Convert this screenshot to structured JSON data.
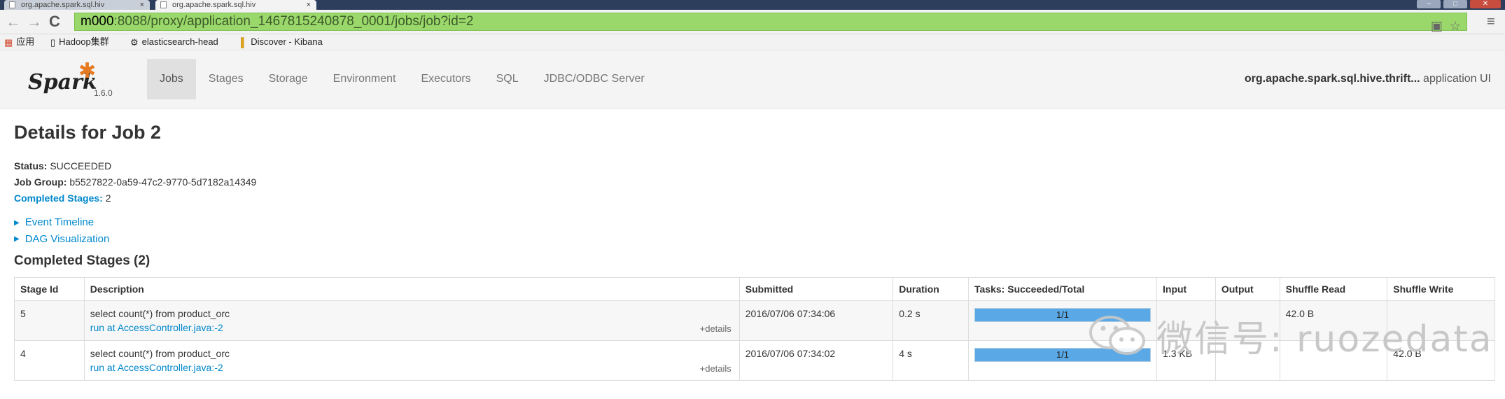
{
  "browser": {
    "tabs": [
      {
        "title": "org.apache.spark.sql.hiv",
        "active": false
      },
      {
        "title": "org.apache.spark.sql.hiv",
        "active": true
      }
    ],
    "tab_close": "×",
    "url_host": "m000",
    "url_rest": ":8088/proxy/application_1467815240878_0001/jobs/job?id=2",
    "bookmarks": [
      "应用",
      "Hadoop集群",
      "elasticsearch-head",
      "Discover - Kibana"
    ]
  },
  "spark_nav": {
    "logo_text": "Spark",
    "version": "1.6.0",
    "tabs": [
      "Jobs",
      "Stages",
      "Storage",
      "Environment",
      "Executors",
      "SQL",
      "JDBC/ODBC Server"
    ],
    "active_tab": "Jobs",
    "app_name": "org.apache.spark.sql.hive.thrift...",
    "app_suffix": " application UI"
  },
  "job": {
    "heading": "Details for Job 2",
    "status_label": "Status:",
    "status_value": " SUCCEEDED",
    "group_label": "Job Group:",
    "group_value": " b5527822-0a59-47c2-9770-5d7182a14349",
    "completed_label": "Completed Stages:",
    "completed_value": " 2"
  },
  "toggles": {
    "event_timeline": "Event Timeline",
    "dag": "DAG Visualization"
  },
  "stages_section": {
    "heading": "Completed Stages (2)",
    "columns": [
      "Stage Id",
      "Description",
      "Submitted",
      "Duration",
      "Tasks: Succeeded/Total",
      "Input",
      "Output",
      "Shuffle Read",
      "Shuffle Write"
    ],
    "rows": [
      {
        "stage_id": "5",
        "desc": "select count(*) from product_orc",
        "desc_link": "run at AccessController.java:-2",
        "details": "+details",
        "submitted": "2016/07/06 07:34:06",
        "duration": "0.2 s",
        "tasks": "1/1",
        "tasks_fraction": 1.0,
        "input": "",
        "output": "",
        "shuffle_read": "42.0 B",
        "shuffle_write": ""
      },
      {
        "stage_id": "4",
        "desc": "select count(*) from product_orc",
        "desc_link": "run at AccessController.java:-2",
        "details": "+details",
        "submitted": "2016/07/06 07:34:02",
        "duration": "4 s",
        "tasks": "1/1",
        "tasks_fraction": 1.0,
        "input": "1.3 KB",
        "output": "",
        "shuffle_read": "",
        "shuffle_write": "42.0 B"
      }
    ]
  },
  "watermark": {
    "text": "微信号: ruozedata",
    "color": "#c8c8c8"
  },
  "colors": {
    "link": "#0088cc",
    "progress_fill": "#5aa9e6",
    "spark_orange": "#e57a22",
    "url_bar": "#9bd86b"
  }
}
